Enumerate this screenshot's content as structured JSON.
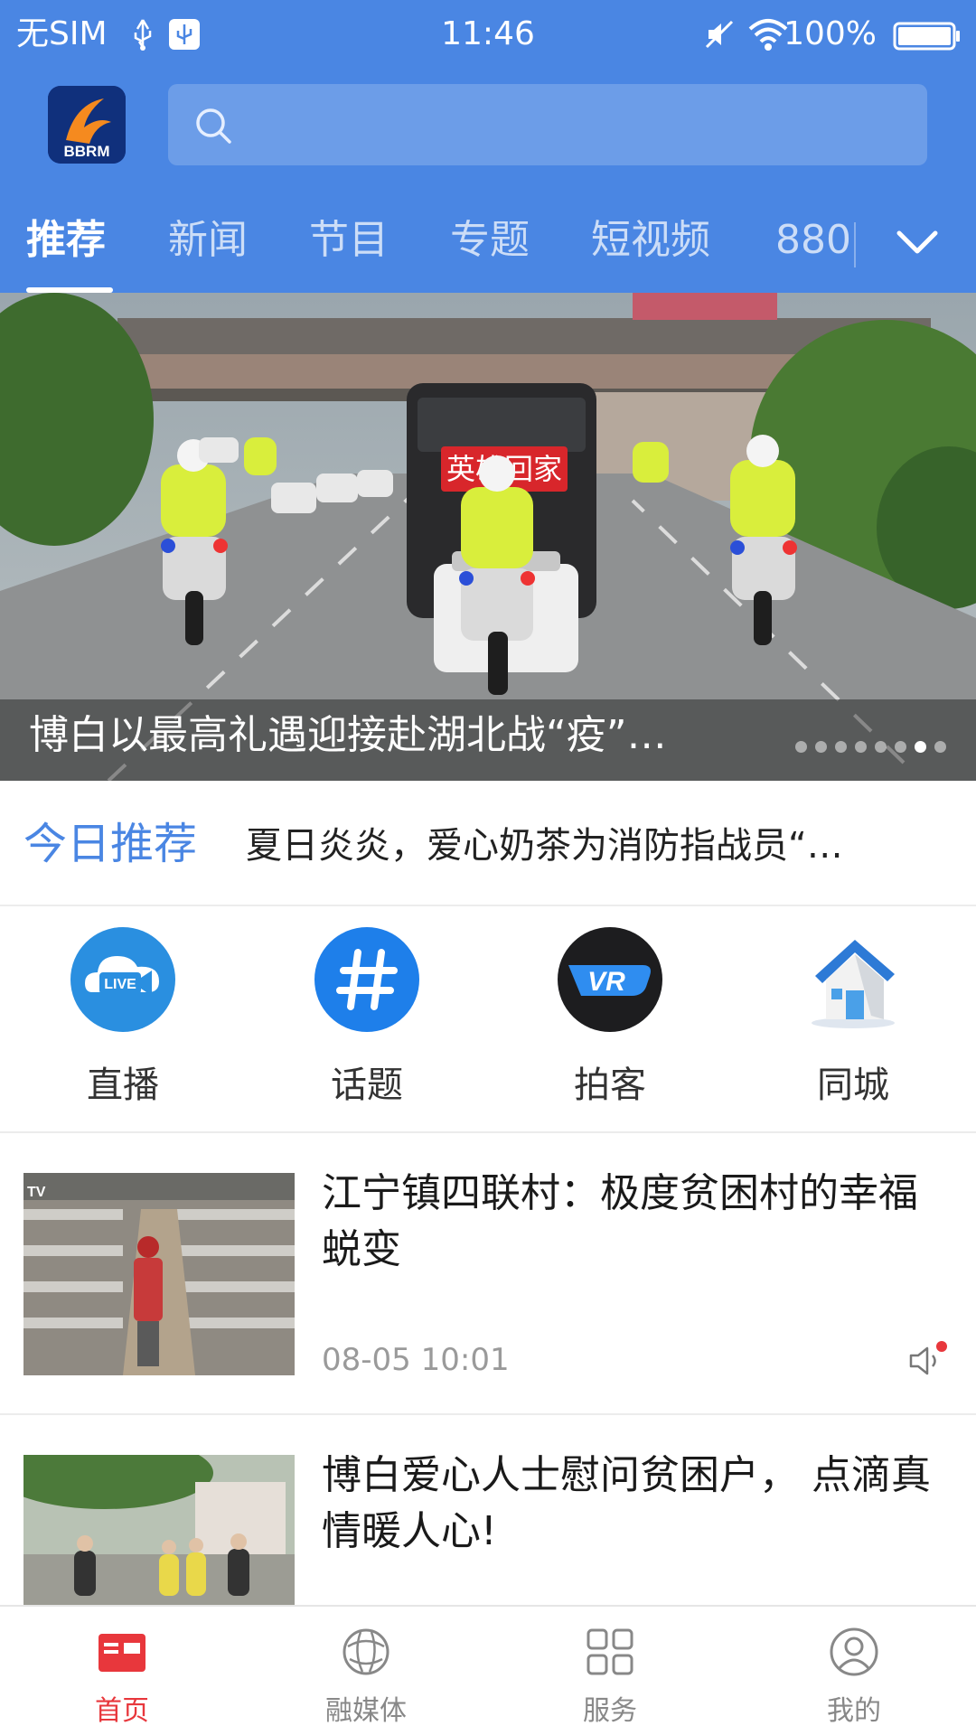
{
  "status_bar": {
    "carrier": "无SIM",
    "time": "11:46",
    "battery": "100%",
    "icons": [
      "usb-icon",
      "usb-debug-icon",
      "mute-icon",
      "wifi-icon",
      "battery-icon"
    ]
  },
  "header": {
    "logo_text": "BBRM",
    "search_icon": "search-icon",
    "background_color": "#4a86e3"
  },
  "tabs": {
    "items": [
      {
        "label": "推荐",
        "active": true
      },
      {
        "label": "新闻",
        "active": false
      },
      {
        "label": "节目",
        "active": false
      },
      {
        "label": "专题",
        "active": false
      },
      {
        "label": "短视频",
        "active": false
      },
      {
        "label": "880",
        "active": false
      }
    ],
    "expand_icon": "chevron-down-icon"
  },
  "banner": {
    "caption": "博白以最高礼遇迎接赴湖北战“疫”…",
    "sign_text": "英雄回家",
    "dot_count": 8,
    "active_dot": 6
  },
  "today": {
    "label": "今日推荐",
    "headline": "夏日炎炎，爱心奶茶为消防指战员“…"
  },
  "quick_entries": [
    {
      "label": "直播",
      "icon": "live-camera-icon",
      "icon_text": "LIVE"
    },
    {
      "label": "话题",
      "icon": "hashtag-icon"
    },
    {
      "label": "拍客",
      "icon": "vr-icon",
      "icon_text": "VR"
    },
    {
      "label": "同城",
      "icon": "house-icon"
    }
  ],
  "news": [
    {
      "title": "江宁镇四联村：极度贫困村的幸福蜕变",
      "time": "08-05 10:01",
      "thumb_badge": "TV",
      "has_audio": true
    },
    {
      "title": "博白爱心人士慰问贫困户， 点滴真情暖人心!",
      "time": "",
      "has_audio": false
    }
  ],
  "bottom_nav": [
    {
      "label": "首页",
      "icon": "home-news-icon",
      "active": true
    },
    {
      "label": "融媒体",
      "icon": "globe-icon",
      "active": false
    },
    {
      "label": "服务",
      "icon": "grid-icon",
      "active": false
    },
    {
      "label": "我的",
      "icon": "user-icon",
      "active": false
    }
  ],
  "colors": {
    "primary": "#4a86e3",
    "active_nav": "#e8373c",
    "text_dark": "#1a1a1a",
    "text_muted": "#9a9a9a"
  }
}
